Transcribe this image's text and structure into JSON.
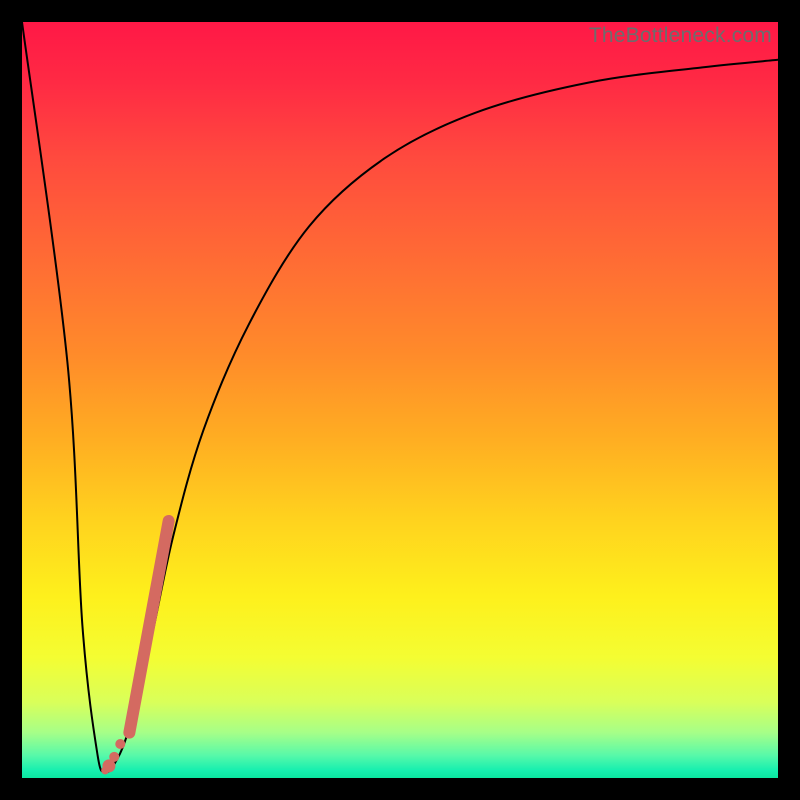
{
  "watermark": "TheBottleneck.com",
  "chart_data": {
    "type": "line",
    "title": "",
    "xlabel": "",
    "ylabel": "",
    "xlim": [
      0,
      100
    ],
    "ylim": [
      0,
      100
    ],
    "grid": false,
    "series": [
      {
        "name": "bottleneck-curve",
        "x": [
          0,
          6,
          8,
          10,
          11,
          12,
          14,
          17,
          20,
          24,
          30,
          38,
          48,
          60,
          75,
          90,
          100
        ],
        "values": [
          100,
          55,
          20,
          3,
          1,
          1.5,
          6,
          18,
          32,
          46,
          60,
          73,
          82,
          88,
          92,
          94,
          95
        ]
      }
    ],
    "markers": [
      {
        "name": "highlight-segment",
        "shape": "pill",
        "x1": 14.2,
        "y1": 6,
        "x2": 19.4,
        "y2": 34,
        "color": "#d46a61",
        "width": 12
      },
      {
        "name": "dot-a",
        "shape": "circle",
        "x": 13.0,
        "y": 4.5,
        "color": "#d46a61",
        "r": 5
      },
      {
        "name": "dot-b",
        "shape": "circle",
        "x": 12.2,
        "y": 2.8,
        "color": "#d46a61",
        "r": 5
      },
      {
        "name": "dot-c",
        "shape": "circle",
        "x": 11.5,
        "y": 1.6,
        "color": "#d46a61",
        "r": 6.5
      },
      {
        "name": "dot-d",
        "shape": "circle",
        "x": 11.0,
        "y": 1.0,
        "color": "#d46a61",
        "r": 4
      }
    ],
    "background_gradient": {
      "top": "#ff1846",
      "bottom": "#0be6a0"
    }
  }
}
